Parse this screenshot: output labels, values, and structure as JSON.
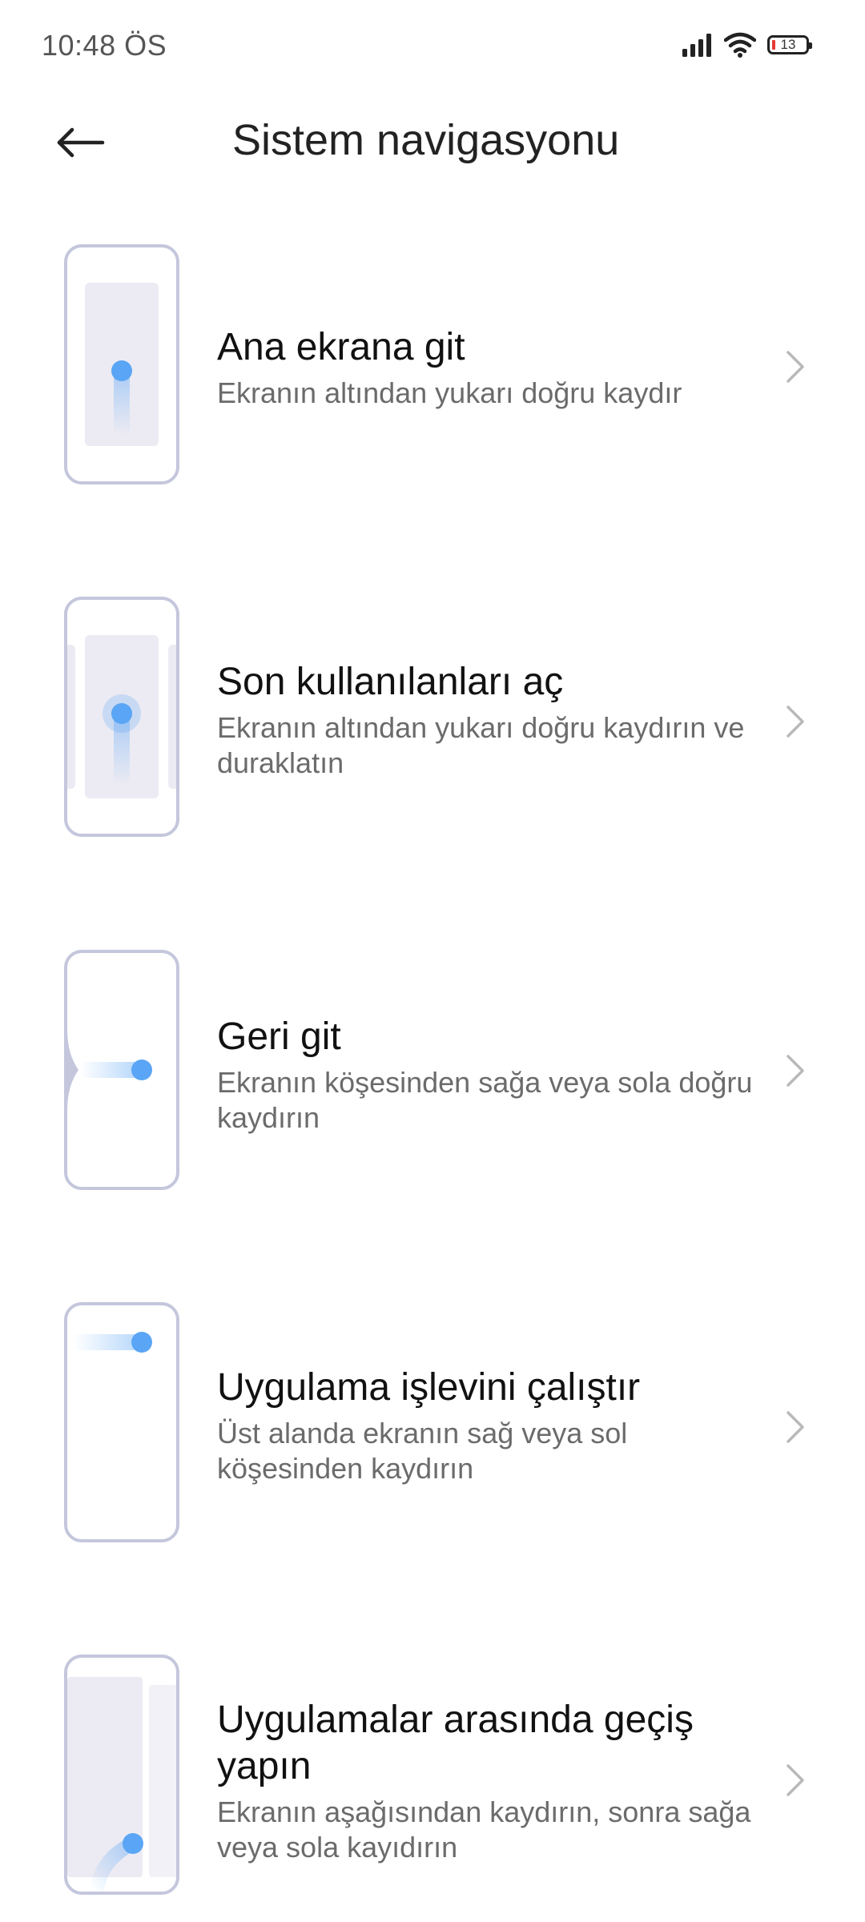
{
  "status_bar": {
    "time": "10:48 ÖS",
    "battery_level": "13",
    "icons": [
      "signal-icon",
      "wifi-icon",
      "battery-icon"
    ]
  },
  "header": {
    "back_icon": "arrow-left-icon",
    "title": "Sistem navigasyonu"
  },
  "colors": {
    "accent_dot": "#5aa5f5",
    "frame": "#c4c7dc",
    "panel": "#ecebf3",
    "chevron": "#b9b9b9"
  },
  "items": [
    {
      "title": "Ana ekrana git",
      "description": "Ekranın altından yukarı doğru kaydır",
      "thumb_icon": "swipe-up-home-illustration"
    },
    {
      "title": "Son kullanılanları aç",
      "description": "Ekranın altından yukarı doğru kaydırın ve duraklatın",
      "thumb_icon": "swipe-up-pause-recents-illustration"
    },
    {
      "title": "Geri git",
      "description": "Ekranın köşesinden sağa veya sola doğru kaydırın",
      "thumb_icon": "edge-swipe-back-illustration"
    },
    {
      "title": "Uygulama işlevini çalıştır",
      "description": "Üst alanda ekranın sağ veya sol köşesinden kaydırın",
      "thumb_icon": "top-corner-swipe-illustration"
    },
    {
      "title": "Uygulamalar arasında geçiş yapın",
      "description": "Ekranın aşağısından kaydırın, sonra sağa veya sola kayıdırın",
      "thumb_icon": "switch-apps-illustration"
    }
  ]
}
